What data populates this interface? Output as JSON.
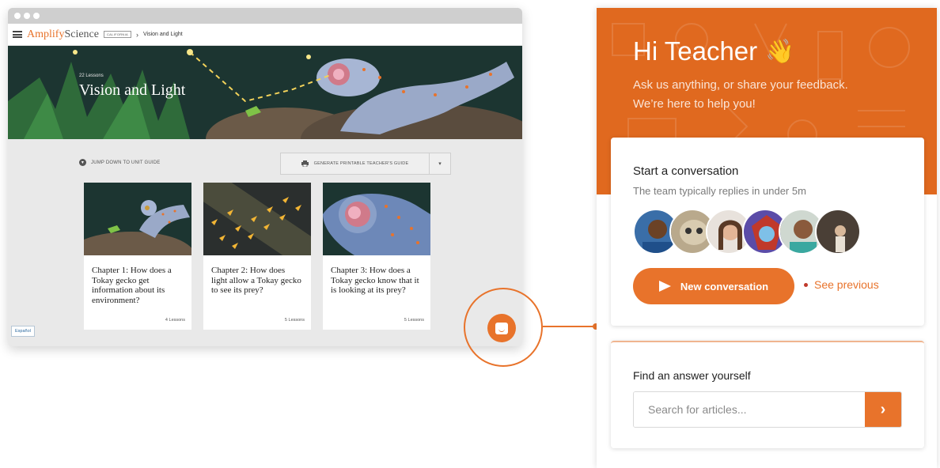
{
  "lms": {
    "brand_part1": "Amplify",
    "brand_part2": "Science",
    "region_badge": "CALIFORNIA",
    "breadcrumb": "Vision and Light",
    "hero": {
      "lessons_count": "22 Lessons",
      "title": "Vision and Light"
    },
    "jump_label": "JUMP DOWN TO UNIT GUIDE",
    "print_label": "GENERATE PRINTABLE TEACHER'S GUIDE",
    "chapters": [
      {
        "title": "Chapter 1: How does a Tokay gecko get information about its environment?",
        "lessons": "4 Lessons"
      },
      {
        "title": "Chapter 2: How does light allow a Tokay gecko to see its prey?",
        "lessons": "5 Lessons"
      },
      {
        "title": "Chapter 3: How does a Tokay gecko know that it is looking at its prey?",
        "lessons": "5 Lessons"
      }
    ],
    "language_button": "Español"
  },
  "messenger": {
    "greeting": "Hi Teacher",
    "wave_emoji": "👋",
    "intro_line1": "Ask us anything, or share your feedback.",
    "intro_line2": "We’re here to help you!",
    "conversation": {
      "title": "Start a conversation",
      "subtitle": "The team typically replies in under 5m",
      "new_button": "New conversation",
      "see_previous": "See previous"
    },
    "find": {
      "title": "Find an answer yourself",
      "search_placeholder": "Search for articles..."
    }
  },
  "colors": {
    "accent": "#e8732b",
    "header": "#e0691f",
    "hero_bg": "#1e3430"
  },
  "icons": [
    "hamburger-icon",
    "print-icon",
    "chevron-down-icon",
    "send-icon",
    "chevron-right-icon",
    "chat-launcher-icon",
    "wave-emoji"
  ]
}
